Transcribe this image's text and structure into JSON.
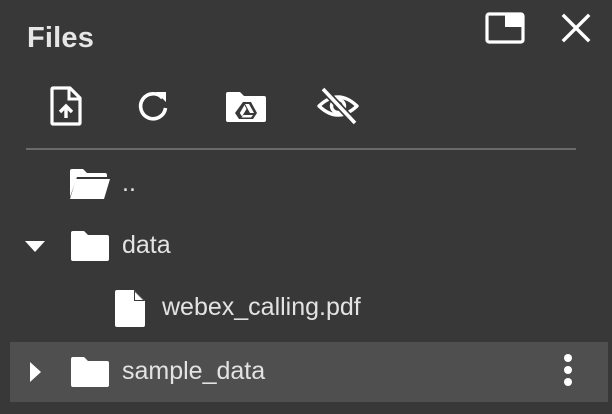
{
  "panel": {
    "title": "Files"
  },
  "header": {
    "buttons": [
      {
        "icon": "new-window-icon"
      },
      {
        "icon": "close-icon"
      }
    ]
  },
  "toolbar": {
    "buttons": [
      {
        "icon": "upload-file-icon"
      },
      {
        "icon": "refresh-icon"
      },
      {
        "icon": "mount-drive-icon"
      },
      {
        "icon": "hide-files-icon"
      }
    ]
  },
  "tree": {
    "items": [
      {
        "label": "..",
        "type": "parent-folder"
      },
      {
        "label": "data",
        "type": "folder",
        "expanded": true
      },
      {
        "label": "webex_calling.pdf",
        "type": "file"
      },
      {
        "label": "sample_data",
        "type": "folder",
        "expanded": false,
        "selected": true
      }
    ]
  },
  "colors": {
    "background": "#383838",
    "selected_row": "#4f4f4f",
    "text": "#e3e3e3",
    "divider": "#6a6a6a",
    "icon": "#ffffff"
  }
}
